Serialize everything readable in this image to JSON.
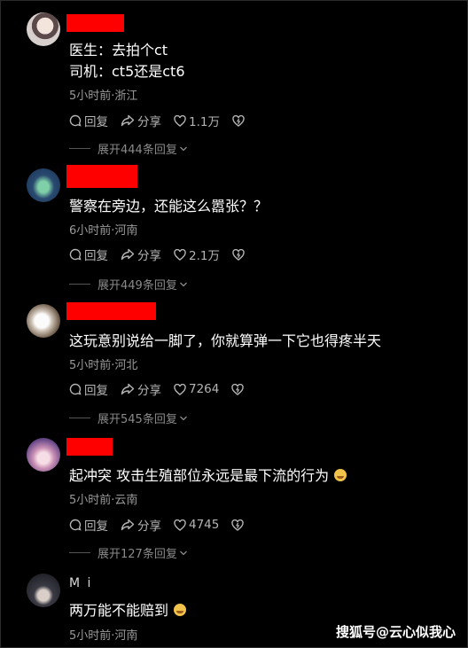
{
  "comments": [
    {
      "content": [
        "医生：去拍个ct",
        "司机：ct5还是ct6"
      ],
      "meta": "5小时前·浙江",
      "reply_label": "回复",
      "share_label": "分享",
      "likes": "1.1万",
      "expand": "展开444条回复"
    },
    {
      "content": [
        "警察在旁边，还能这么嚣张？？"
      ],
      "meta": "6小时前·河南",
      "reply_label": "回复",
      "share_label": "分享",
      "likes": "2.1万",
      "expand": "展开449条回复"
    },
    {
      "content": [
        "这玩意别说给一脚了，你就算弹一下它也得疼半天"
      ],
      "meta": "5小时前·河北",
      "reply_label": "回复",
      "share_label": "分享",
      "likes": "7264",
      "expand": "展开545条回复"
    },
    {
      "content": [
        "起冲突 攻击生殖部位永远是最下流的行为"
      ],
      "meta": "5小时前·云南",
      "reply_label": "回复",
      "share_label": "分享",
      "likes": "4745",
      "expand": "展开127条回复"
    },
    {
      "username": "M i",
      "content": [
        "两万能不能赔到"
      ],
      "meta": "5小时前·河南"
    }
  ],
  "watermark": "搜狐号@云心似我心",
  "colors": {
    "background": "#000000",
    "redaction": "#ff0000",
    "meta_text": "#9a9a9a"
  }
}
